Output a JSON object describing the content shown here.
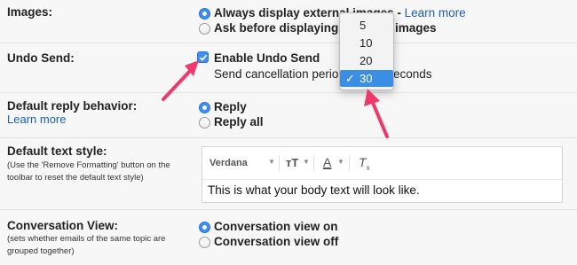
{
  "colors": {
    "accent": "#3d8ef1",
    "link": "#1a5fb4",
    "annotation": "#ee3a6a"
  },
  "images": {
    "label": "Images:",
    "option1": "Always display external images - ",
    "option1_link": "Learn more",
    "option2_before": "Ask before displaying e",
    "option2_after": "images"
  },
  "undo_send": {
    "label": "Undo Send:",
    "checkbox_label": "Enable Undo Send",
    "period_before": "Send cancellation perio",
    "period_after": "econds",
    "options": [
      "5",
      "10",
      "20",
      "30"
    ],
    "selected": "30"
  },
  "reply": {
    "label": "Default reply behavior:",
    "link": "Learn more",
    "option1": "Reply",
    "option2": "Reply all"
  },
  "text_style": {
    "label": "Default text style:",
    "help": "(Use the 'Remove Formatting' button on the toolbar to reset the default text style)",
    "font": "Verdana",
    "size_icon": "text-size-icon",
    "color_icon": "text-color-icon",
    "clear_icon": "remove-formatting-icon",
    "sample": "This is what your body text will look like."
  },
  "conversation": {
    "label": "Conversation View:",
    "help": "(sets whether emails of the same topic are grouped together)",
    "option1": "Conversation view on",
    "option2": "Conversation view off"
  }
}
